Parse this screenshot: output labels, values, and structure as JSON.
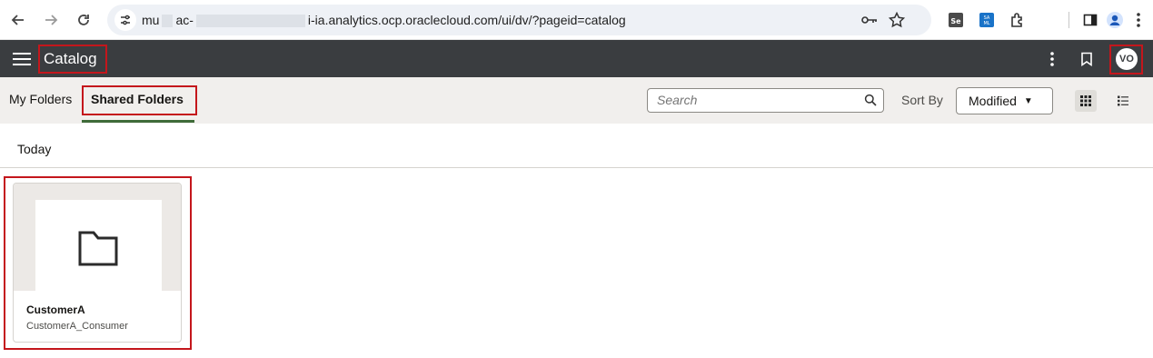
{
  "browser": {
    "url_prefix": "mu",
    "url_mid": "ac-",
    "url_suffix": "i-ia.analytics.ocp.oraclecloud.com/ui/dv/?pageid=catalog"
  },
  "header": {
    "title": "Catalog",
    "avatar_initials": "VO"
  },
  "toolbar": {
    "tabs": [
      {
        "label": "My Folders",
        "selected": false
      },
      {
        "label": "Shared Folders",
        "selected": true
      }
    ],
    "search_placeholder": "Search",
    "sort_label": "Sort By",
    "sort_value": "Modified",
    "view_mode": "grid"
  },
  "content": {
    "section_title": "Today",
    "items": [
      {
        "name": "CustomerA",
        "subtitle": "CustomerA_Consumer",
        "icon": "folder-icon"
      }
    ]
  },
  "colors": {
    "header_bg": "#3a3d40",
    "toolbar_bg": "#f1efed",
    "highlight": "#c4161c",
    "tab_underline": "#3f6b39"
  }
}
